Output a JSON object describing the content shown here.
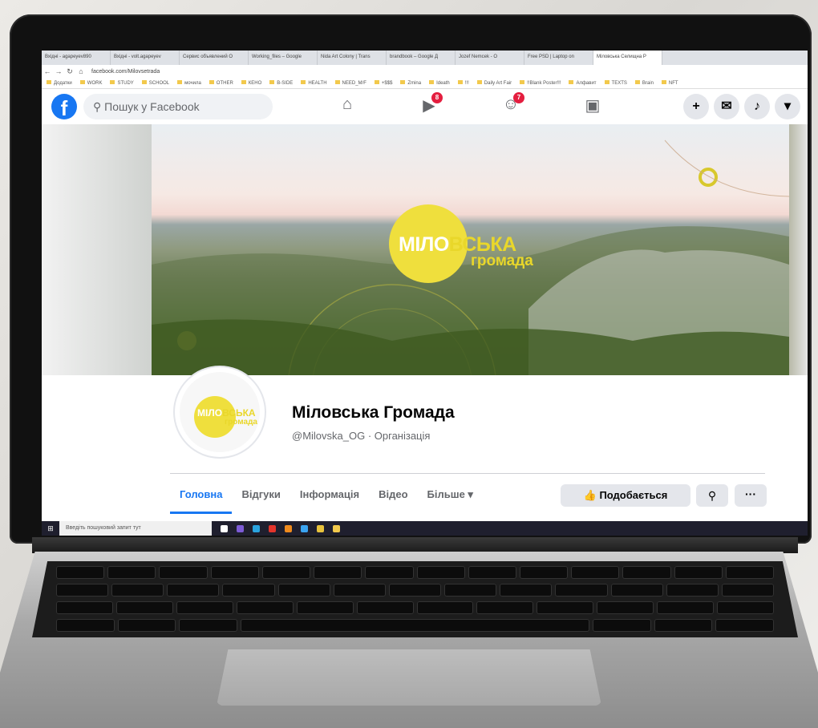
{
  "browser": {
    "tabs": [
      "Вхідні - agapeyev890",
      "Вхідні - volt.agapeyev",
      "Сервис объявлений О",
      "Working_files – Google",
      "Nida Art Colony | Trans",
      "brandbook – Google Д",
      "Jozef Nemcek - О",
      "Free PSD | Laptop on",
      "Міловська Селищна Р"
    ],
    "active_tab": 8,
    "url": "facebook.com/Milovsetrada",
    "bookmarks": [
      "Додатки",
      "WORK",
      "STUDY",
      "SCHOOL",
      "мочила",
      "OTHER",
      "КЕНО",
      "B-SIDE",
      "HEALTH",
      "NEED_M/F",
      "+$$$",
      "Zmina",
      "Ideath",
      "!!!",
      "Daily Art Fair",
      "!!Blank Poster!!!",
      "Алфавит",
      "TEXTS",
      "Brain",
      "NFT"
    ]
  },
  "facebook": {
    "logo": "f",
    "search_placeholder": "Пошук у Facebook",
    "watch_badge": "8",
    "groups_badge": "7"
  },
  "cover": {
    "logo_part1": "МІЛО",
    "logo_part2": "ВСЬКА",
    "logo_sub": "громада"
  },
  "avatar": {
    "logo_part1": "МІЛО",
    "logo_part2": "ВСЬКА",
    "logo_sub": "громада"
  },
  "page": {
    "name": "Міловська Громада",
    "handle": "@Milovska_OG · Організація",
    "tabs": [
      "Головна",
      "Відгуки",
      "Інформація",
      "Відео",
      "Більше ▾"
    ],
    "like_button": "Подобається"
  },
  "taskbar": {
    "search_placeholder": "Введіть пошуковий запит тут"
  },
  "colors": {
    "facebook_blue": "#1877f2",
    "brand_yellow": "#efdf3d",
    "badge_red": "#e41e3f"
  }
}
